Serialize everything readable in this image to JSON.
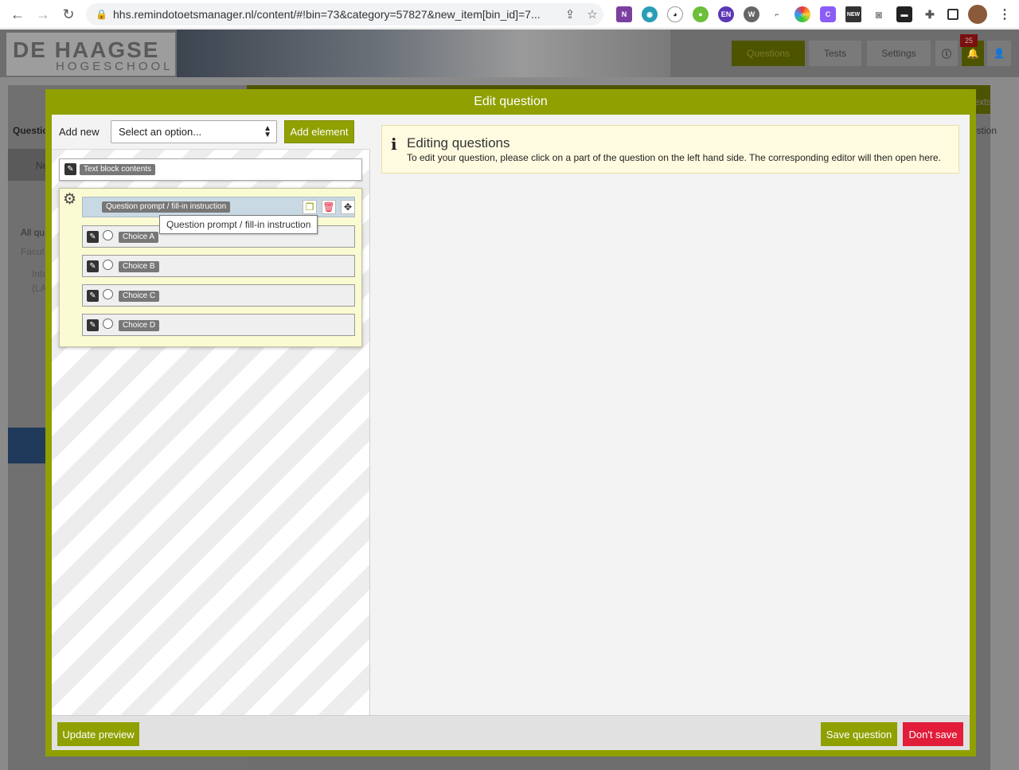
{
  "browser": {
    "url": "hhs.remindotoetsmanager.nl/content/#!bin=73&category=57827&new_item[bin_id]=7...",
    "ext_en": "EN",
    "ext_new": "NEW"
  },
  "site": {
    "logo_line1": "DE HAAGSE",
    "logo_line2": "HOGESCHOOL",
    "nav": [
      "Questions",
      "Tests",
      "Settings"
    ],
    "notification_count": "25",
    "side_texts": [
      "Questio",
      "Ne",
      "All qu",
      "Facul",
      "Inte",
      "(LA",
      "texts",
      "estion"
    ]
  },
  "modal": {
    "title": "Edit question",
    "add_new_label": "Add new",
    "select_value": "Select an option...",
    "add_element_label": "Add element",
    "text_block_tag": "Text block contents",
    "prompt_tag": "Question prompt / fill-in instruction",
    "tooltip": "Question prompt / fill-in instruction",
    "choices": [
      "Choice A",
      "Choice B",
      "Choice C",
      "Choice D"
    ],
    "info_title": "Editing questions",
    "info_text": "To edit your question, please click on a part of the question on the left hand side. The corresponding editor will then open here.",
    "update_preview": "Update preview",
    "save_question": "Save question",
    "dont_save": "Don't save"
  },
  "colors": {
    "accent": "#8fa000",
    "danger": "#e11d3a",
    "info_bg": "#fffbe0"
  }
}
